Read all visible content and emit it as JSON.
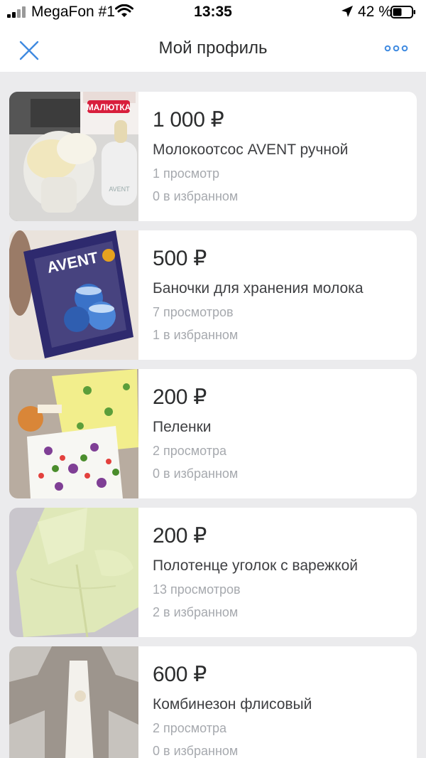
{
  "status_bar": {
    "carrier": "MegaFon #1",
    "time": "13:35",
    "battery": "42 %"
  },
  "header": {
    "title": "Мой профиль"
  },
  "colors": {
    "accent": "#3f8ae0",
    "background": "#ebebed",
    "card": "#ffffff",
    "secondary_text": "#a6a9ae"
  },
  "listings": [
    {
      "price": "1 000 ₽",
      "title": "Молокоотсос AVENT ручной",
      "views": "1 просмотр",
      "favorites": "0 в избранном",
      "image_text": "МАЛЮТКА",
      "image_icon": "breast-pump-photo"
    },
    {
      "price": "500 ₽",
      "title": "Баночки для хранения молока",
      "views": "7 просмотров",
      "favorites": "1 в избранном",
      "image_text": "AVENT",
      "image_icon": "milk-containers-photo"
    },
    {
      "price": "200 ₽",
      "title": "Пеленки",
      "views": "2 просмотра",
      "favorites": "0 в избранном",
      "image_icon": "diapers-photo"
    },
    {
      "price": "200 ₽",
      "title": "Полотенце уголок с варежкой",
      "views": "13 просмотров",
      "favorites": "2 в избранном",
      "image_icon": "towel-photo"
    },
    {
      "price": "600 ₽",
      "title": "Комбинезон флисовый",
      "views": "2 просмотра",
      "favorites": "0 в избранном",
      "image_icon": "fleece-overall-photo"
    }
  ]
}
